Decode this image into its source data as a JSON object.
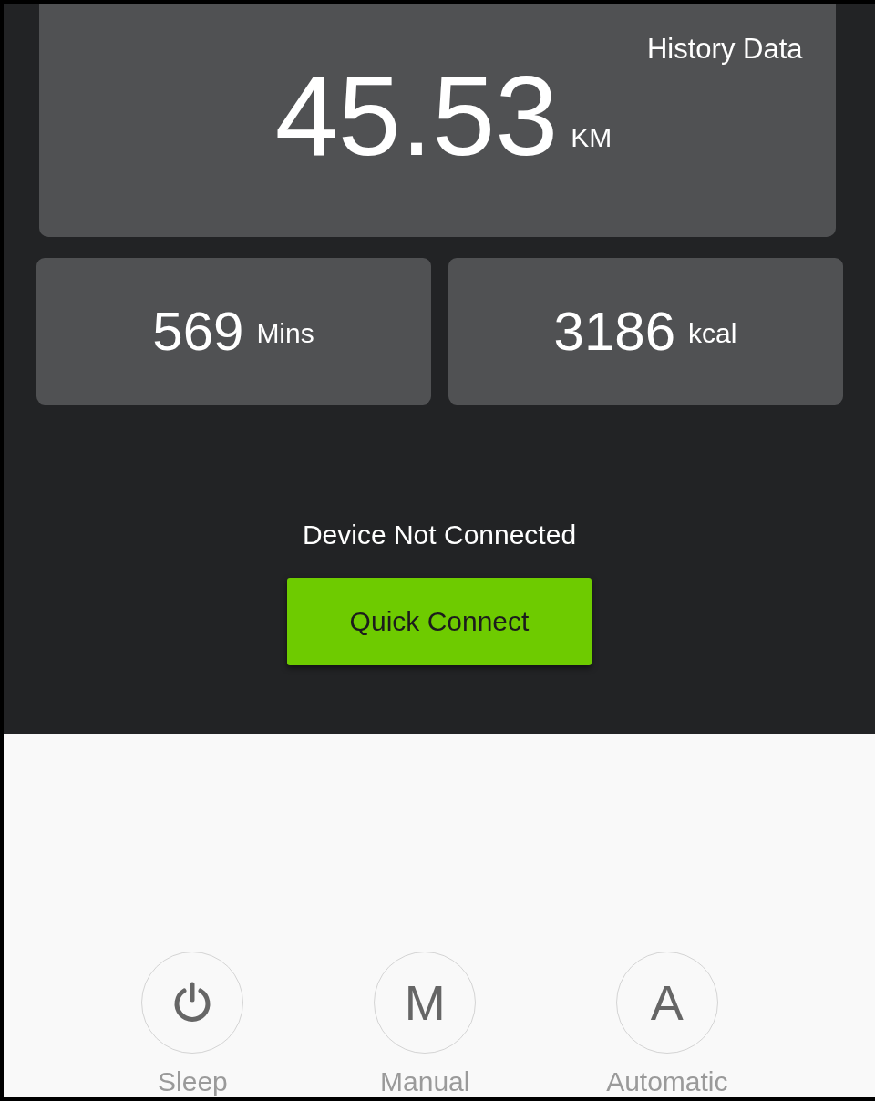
{
  "summary": {
    "label": "History Data",
    "distance": {
      "value": "45.53",
      "unit": "KM"
    }
  },
  "stats": [
    {
      "value": "569",
      "unit": "Mins"
    },
    {
      "value": "3186",
      "unit": "kcal"
    }
  ],
  "connection": {
    "status": "Device Not Connected",
    "button": "Quick Connect"
  },
  "modes": [
    {
      "kind": "power",
      "label": "Sleep"
    },
    {
      "kind": "letter",
      "glyph": "M",
      "label": "Manual"
    },
    {
      "kind": "letter",
      "glyph": "A",
      "label": "Automatic"
    }
  ]
}
